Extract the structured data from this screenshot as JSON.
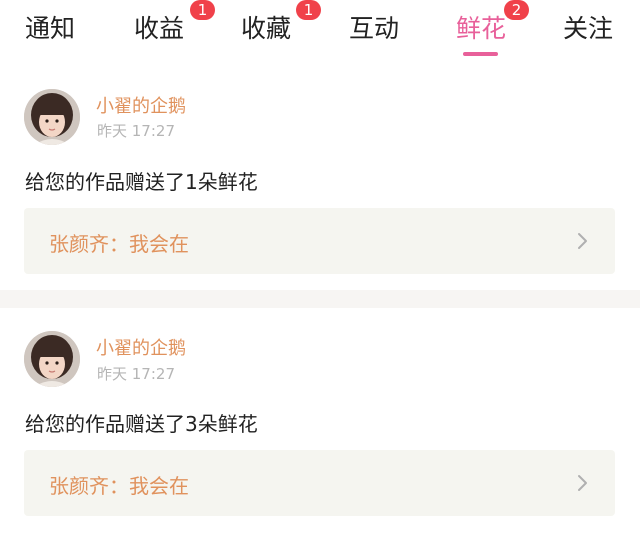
{
  "tabs": [
    {
      "label": "通知",
      "badge": null
    },
    {
      "label": "收益",
      "badge": "1"
    },
    {
      "label": "收藏",
      "badge": "1"
    },
    {
      "label": "互动",
      "badge": null
    },
    {
      "label": "鲜花",
      "badge": "2",
      "active": true
    },
    {
      "label": "关注",
      "badge": null
    }
  ],
  "items": [
    {
      "username": "小翟的企鹅",
      "time": "昨天 17:27",
      "message": "给您的作品赠送了1朵鲜花",
      "reply": "张颜齐：我会在"
    },
    {
      "username": "小翟的企鹅",
      "time": "昨天 17:27",
      "message": "给您的作品赠送了3朵鲜花",
      "reply": "张颜齐：我会在"
    }
  ],
  "colors": {
    "accent": "#e8609a",
    "badge": "#f0414a",
    "username": "#e0925d",
    "reply_bg": "#f5f5f0"
  }
}
